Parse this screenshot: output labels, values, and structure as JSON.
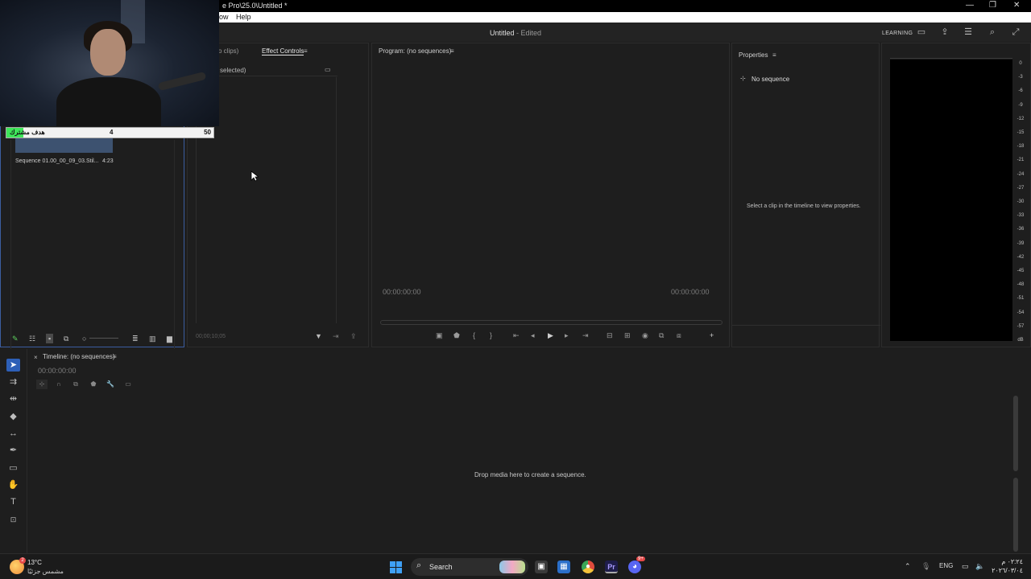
{
  "window": {
    "title": "e Pro\\25.0\\Untitled *",
    "min": "—",
    "max": "❐",
    "close": "✕"
  },
  "menu": {
    "items": [
      "ow",
      "Help"
    ]
  },
  "header": {
    "doc_title": "Untitled",
    "doc_status": "- Edited",
    "learning": "LEARNING"
  },
  "goal": {
    "label": "هدف مشترك",
    "current": "4",
    "target": "50",
    "progress_fraction": 0.08
  },
  "project_panel": {
    "clip_name": "Sequence 01.00_00_09_03.Stil...",
    "clip_duration": "4:23"
  },
  "effect_panel": {
    "tab_clips": "o clips)",
    "tab_effect_controls": "Effect Controls",
    "menu_glyph": "≡",
    "sub_label": "selected)",
    "timecode": "00;00;10;05"
  },
  "program_monitor": {
    "title": "Program: (no sequences)",
    "menu_glyph": "≡",
    "tc_left": "00:00:00:00",
    "tc_right": "00:00:00:00"
  },
  "properties": {
    "title": "Properties",
    "menu_glyph": "≡",
    "no_sequence": "No sequence",
    "hint": "Select a clip in the timeline to view properties."
  },
  "audio_meter": {
    "db_labels": [
      "0",
      "-3",
      "-6",
      "-9",
      "-12",
      "-15",
      "-18",
      "-21",
      "-24",
      "-27",
      "-30",
      "-33",
      "-36",
      "-39",
      "-42",
      "-45",
      "-48",
      "-51",
      "-54",
      "-57",
      "dB"
    ]
  },
  "timeline": {
    "close": "×",
    "title": "Timeline: (no sequences)",
    "menu_glyph": "≡",
    "timecode": "00:00:00:00",
    "drop_hint": "Drop media here to create a sequence."
  },
  "taskbar": {
    "badge": "2",
    "temperature": "13°C",
    "condition": "مشمس جزئيًا",
    "search_label": "Search",
    "language": "ENG",
    "time": "٠٢:٢٤ م",
    "date": "٢٠٢٦/٠٣/٠٤",
    "discord_badge": "9+"
  },
  "colors": {
    "accent": "#2d5fb7",
    "panel_bg": "#1e1e1e",
    "goal_fill": "#3ee65a",
    "project_border": "#3b5da0"
  }
}
